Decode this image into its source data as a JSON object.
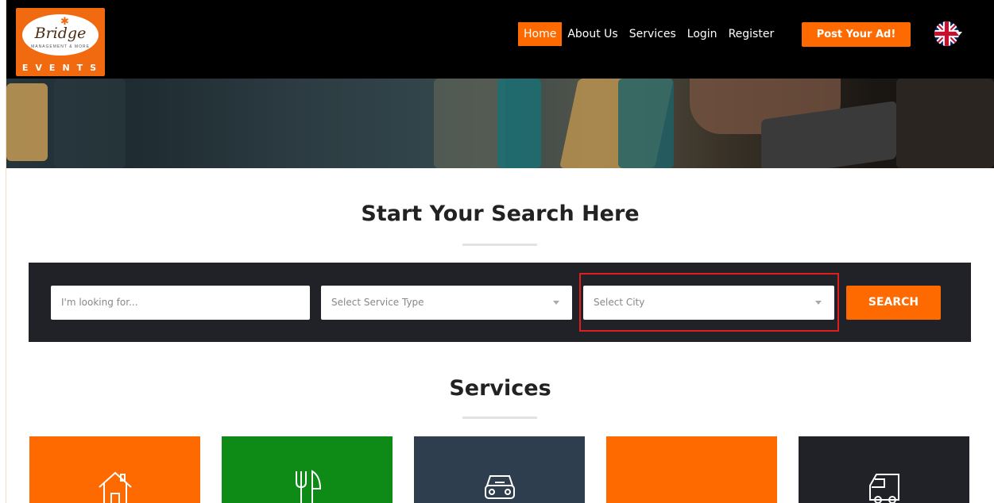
{
  "logo": {
    "script_text": "Bridge",
    "sub_text": "MANAGEMENT & MORE",
    "word": "EVENTS"
  },
  "nav": {
    "items": [
      {
        "label": "Home",
        "active": true
      },
      {
        "label": "About Us",
        "active": false
      },
      {
        "label": "Services",
        "active": false
      },
      {
        "label": "Login",
        "active": false
      },
      {
        "label": "Register",
        "active": false
      }
    ],
    "post_ad_label": "Post Your Ad!",
    "language_icon": "uk-flag-icon"
  },
  "search_section": {
    "title": "Start Your Search Here",
    "keyword_placeholder": "I'm looking for...",
    "service_type_placeholder": "Select Service Type",
    "city_placeholder": "Select City",
    "search_button": "SEARCH"
  },
  "services_section": {
    "title": "Services",
    "cards": [
      {
        "icon": "house-icon",
        "color": "#ff6a00"
      },
      {
        "icon": "fork-knife-icon",
        "color": "#0e8a16"
      },
      {
        "icon": "car-icon",
        "color": "#2e3e4e"
      },
      {
        "icon": "",
        "color": "#ff6a00"
      },
      {
        "icon": "truck-icon",
        "color": "#212128"
      }
    ]
  },
  "colors": {
    "accent": "#ff6a00",
    "nav_bg": "#000000",
    "search_bg": "#212128",
    "highlight": "#e01e1e"
  }
}
